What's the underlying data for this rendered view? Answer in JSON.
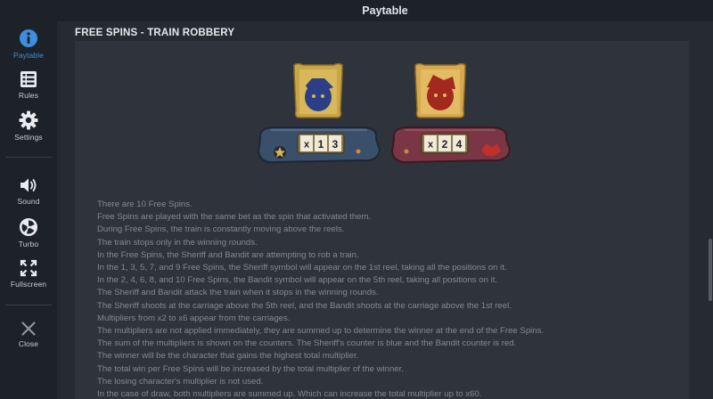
{
  "header": {
    "title": "Paytable"
  },
  "sidebar": {
    "items": [
      {
        "label": "Paytable",
        "icon": "info-icon"
      },
      {
        "label": "Rules",
        "icon": "rules-list-icon"
      },
      {
        "label": "Settings",
        "icon": "gear-icon"
      },
      {
        "label": "Sound",
        "icon": "speaker-icon"
      },
      {
        "label": "Turbo",
        "icon": "turbo-icon"
      },
      {
        "label": "Fullscreen",
        "icon": "fullscreen-icon"
      },
      {
        "label": "Close",
        "icon": "close-icon"
      }
    ],
    "active_index": 0
  },
  "section": {
    "title": "FREE SPINS - TRAIN ROBBERY",
    "counters": [
      {
        "character": "Sheriff",
        "value_label": "x13",
        "color": "#3a4f6a",
        "icon": "sheriff-badge-icon"
      },
      {
        "character": "Bandit",
        "value_label": "x24",
        "color": "#7a3644",
        "icon": "bandit-hat-icon"
      }
    ],
    "lines": [
      "There are 10 Free Spins.",
      "Free Spins are played with the same bet as the spin that activated them.",
      "During Free Spins, the train is constantly moving above the reels.",
      "The train stops only in the winning rounds.",
      "In the Free Spins, the Sheriff and Bandit are attempting to rob a train.",
      "In the 1, 3, 5, 7, and 9 Free Spins, the Sheriff symbol will appear on the 1st reel, taking all the positions on it.",
      "In the 2, 4, 6, 8, and 10 Free Spins, the Bandit symbol will appear on the 5th reel, taking all positions on it.",
      "The Sheriff and Bandit attack the train when it stops in the winning rounds.",
      "The Sheriff shoots at the carriage above the 5th reel, and the Bandit shoots at the carriage above the 1st reel.",
      "Multipliers from x2 to x6 appear from the carriages.",
      "The multipliers are not applied immediately, they are summed up to determine the winner at the end of the Free Spins.",
      "The sum of the multipliers is shown on the counters. The Sheriff's counter is blue and the Bandit counter is red.",
      "The winner will be the character that gains the highest total multiplier.",
      "The total win per Free Spins will be increased by the total multiplier of the winner.",
      "The losing character's multiplier is not used.",
      "In the case of draw, both multipliers are summed up. Which can increase the total multiplier up to x60."
    ]
  },
  "colors": {
    "accent": "#3d8ee0",
    "sidebar_bg": "#1d2128",
    "panel_bg": "#2e333c",
    "text_muted": "#848994"
  }
}
